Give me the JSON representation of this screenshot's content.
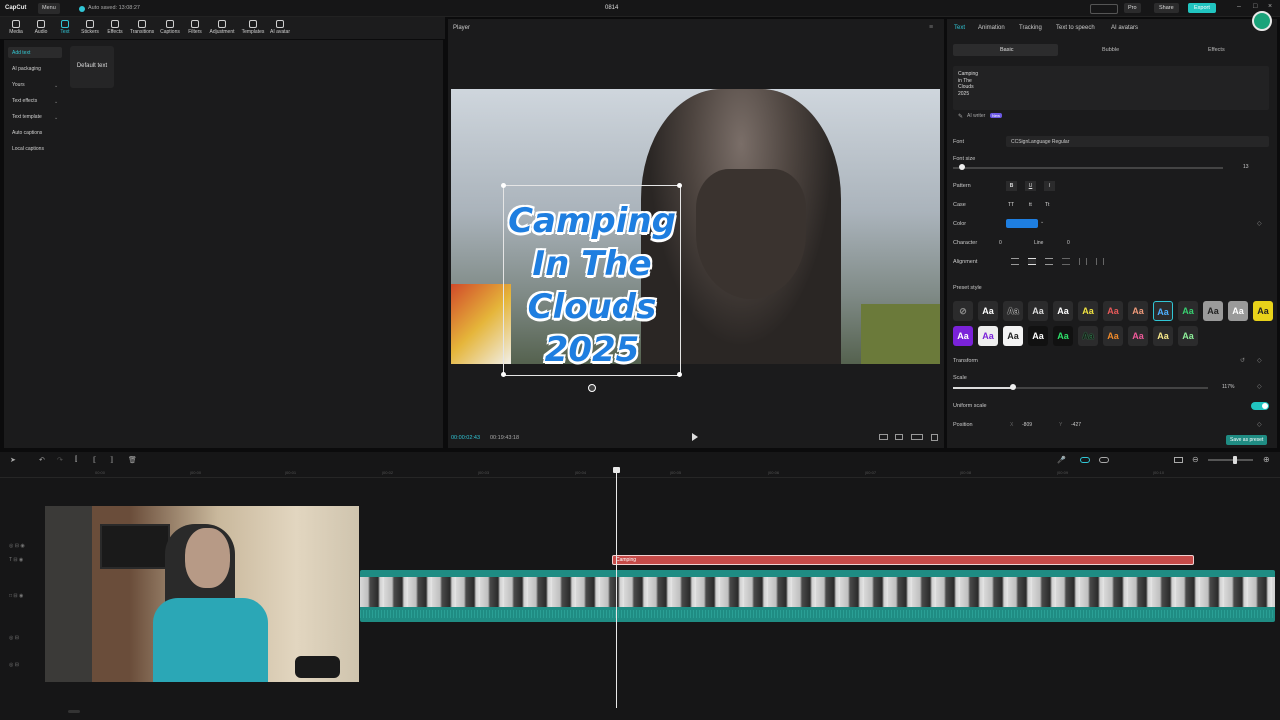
{
  "topbar": {
    "logo": "CapCut",
    "menu": "Menu",
    "autosave": "Auto saved: 13:08:27",
    "title": "0814",
    "pro": "Pro",
    "share": "Share",
    "export": "Export"
  },
  "toolbar": {
    "items": [
      "Media",
      "Audio",
      "Text",
      "Stickers",
      "Effects",
      "Transitions",
      "Captions",
      "Filters",
      "Adjustment",
      "Templates",
      "AI avatar"
    ]
  },
  "leftnav": {
    "items": [
      "Add text",
      "AI packaging",
      "Yours",
      "Text effects",
      "Text template",
      "Auto captions",
      "Local captions"
    ],
    "default_text": "Default text"
  },
  "player": {
    "title": "Player",
    "overlay_text": [
      "Camping",
      "In The",
      "Clouds",
      "2025"
    ],
    "time_current": "00:00:02:43",
    "time_total": "00:19:43:18"
  },
  "rightpanel": {
    "tabs": [
      "Text",
      "Animation",
      "Tracking",
      "Text to speech",
      "AI avatars"
    ],
    "subtabs": [
      "Basic",
      "Bubble",
      "Effects"
    ],
    "text_lines": [
      "Camping",
      "in The",
      "Clouds",
      "2025"
    ],
    "ai_writer": "AI writer",
    "ai_writer_badge": "New",
    "font_label": "Font",
    "font_value": "CCSignLanguage Regular",
    "font_size_label": "Font size",
    "font_size_value": "13",
    "pattern_label": "Pattern",
    "pattern_b": "B",
    "pattern_u": "U",
    "pattern_i": "I",
    "case_label": "Case",
    "case_opts": [
      "TT",
      "tt",
      "Tt"
    ],
    "color_label": "Color",
    "color_value": "#1e7ee0",
    "character_label": "Character",
    "character_value": "0",
    "line_label": "Line",
    "line_value": "0",
    "alignment_label": "Alignment",
    "preset_label": "Preset style",
    "preset_glyph": "Aa",
    "transform_label": "Transform",
    "scale_label": "Scale",
    "scale_value": "117%",
    "uniform_label": "Uniform scale",
    "position_label": "Position",
    "pos_x_label": "X",
    "pos_x": "-809",
    "pos_y_label": "Y",
    "pos_y": "-427",
    "save_preset": "Save as preset"
  },
  "timeline": {
    "clip_label": "Camping",
    "ticks": [
      "00:00",
      "|00:00",
      "|00:01",
      "|00:02",
      "|00:03",
      "|00:04",
      "|00:05",
      "|00:06",
      "|00:07",
      "|00:08",
      "|00:09",
      "|00:10"
    ]
  },
  "colors": {
    "accent": "#31c6d6",
    "export": "#21c4c0",
    "text_clip": "#c54a48",
    "video_track": "#1f8c83"
  }
}
